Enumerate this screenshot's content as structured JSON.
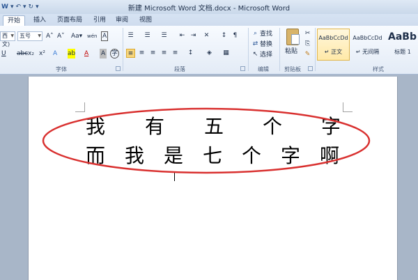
{
  "title_bar": {
    "title": "新建 Microsoft Word 文档.docx - Microsoft Word",
    "qat": [
      "W",
      "▾",
      "↶",
      "▾",
      "↻",
      "▾"
    ]
  },
  "tabs": [
    {
      "label": "开始",
      "active": true
    },
    {
      "label": "插入",
      "active": false
    },
    {
      "label": "页面布局",
      "active": false
    },
    {
      "label": "引用",
      "active": false
    },
    {
      "label": "审阅",
      "active": false
    },
    {
      "label": "视图",
      "active": false
    }
  ],
  "ribbon": {
    "font": {
      "font_name": "西文)",
      "font_size": "五号",
      "grow": "A˄",
      "shrink": "A˅",
      "change_case": "Aa▾",
      "phonetic": "wén",
      "border_char": "A",
      "underline": "U",
      "strike": "abc",
      "subscript": "x₂",
      "superscript": "x²",
      "text_effect": "A",
      "highlight": "ab",
      "font_color": "A",
      "char_shading": "A",
      "enclose": "字",
      "label": "字体"
    },
    "paragraph": {
      "label": "段落"
    },
    "edit": {
      "find": "查找",
      "replace": "替换",
      "select": "选择",
      "label": "编辑"
    },
    "clipboard": {
      "paste": "粘贴",
      "label": "剪贴板"
    },
    "styles": {
      "items": [
        {
          "sample": "AaBbCcDd",
          "name": "↵ 正文",
          "selected": true
        },
        {
          "sample": "AaBbCcDd",
          "name": "↵ 无间隔",
          "selected": false
        },
        {
          "sample": "AaBb",
          "name": "标题 1",
          "selected": false
        }
      ],
      "label": "样式"
    }
  },
  "document": {
    "line1": [
      "我",
      "有",
      "五",
      "个",
      "字"
    ],
    "line2": [
      "而",
      "我",
      "是",
      "七",
      "个",
      "字",
      "啊"
    ]
  },
  "annotation": {
    "ellipse_color": "#d9302f"
  }
}
